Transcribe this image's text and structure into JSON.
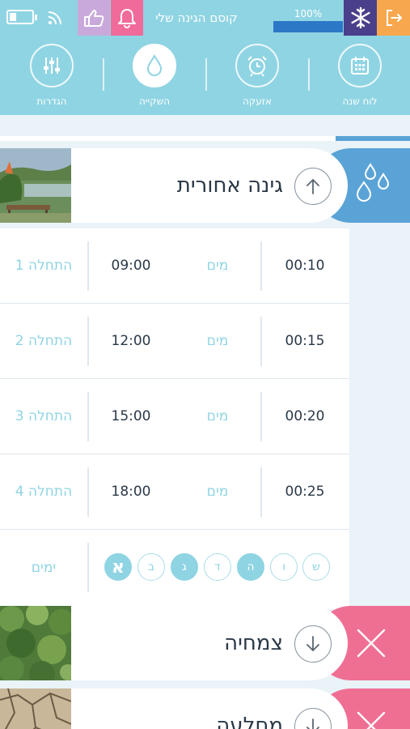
{
  "status_bar": {
    "garden_title": "קוסם הגינה שלי",
    "battery_percent": "100%",
    "progress_fraction": 1.0,
    "icons": [
      "battery-icon",
      "wifi-icon",
      "thumbs-up-icon",
      "bell-icon",
      "snowflake-icon",
      "exit-icon"
    ],
    "colors": {
      "bar_bg": "#8fd4e3",
      "like": "#c9a9dc",
      "bell": "#f06b9a",
      "snow": "#4a3f8a",
      "exit": "#f7a84e",
      "progress": "#2c78c7"
    }
  },
  "toolbar": {
    "items": [
      {
        "label": "לוח שנה",
        "icon": "calendar-icon"
      },
      {
        "label": "אזעקה",
        "icon": "alarm-clock-icon"
      },
      {
        "label": "השקייה",
        "icon": "water-drop-icon",
        "active": true
      },
      {
        "label": "הגדרות",
        "icon": "sliders-icon"
      }
    ]
  },
  "zones": [
    {
      "name": "גינה אחורית",
      "expanded": true,
      "badge_color": "#5aa3d6",
      "badge_icon": "water-drops-icon",
      "arrow_icon": "arrow-up-icon",
      "schedule": [
        {
          "start_label": "התחלה 1",
          "time": "09:00",
          "water_label": "מים",
          "duration": "00:10"
        },
        {
          "start_label": "התחלה 2",
          "time": "12:00",
          "water_label": "מים",
          "duration": "00:15"
        },
        {
          "start_label": "התחלה 3",
          "time": "15:00",
          "water_label": "מים",
          "duration": "00:20"
        },
        {
          "start_label": "התחלה 4",
          "time": "18:00",
          "water_label": "מים",
          "duration": "00:25"
        }
      ],
      "days_label": "ימים",
      "days": [
        {
          "letter": "ש",
          "on": false
        },
        {
          "letter": "ו",
          "on": false
        },
        {
          "letter": "ה",
          "on": true
        },
        {
          "letter": "ד",
          "on": false
        },
        {
          "letter": "ג",
          "on": true
        },
        {
          "letter": "ב",
          "on": false
        },
        {
          "letter": "א",
          "on": true
        }
      ]
    },
    {
      "name": "צמחיה",
      "expanded": false,
      "badge_color": "#ef6f93",
      "badge_icon": "close-x-icon",
      "arrow_icon": "arrow-down-icon"
    },
    {
      "name": "מחלעה",
      "expanded": false,
      "badge_color": "#ef6f93",
      "badge_icon": "close-x-icon",
      "arrow_icon": "arrow-down-icon"
    }
  ]
}
